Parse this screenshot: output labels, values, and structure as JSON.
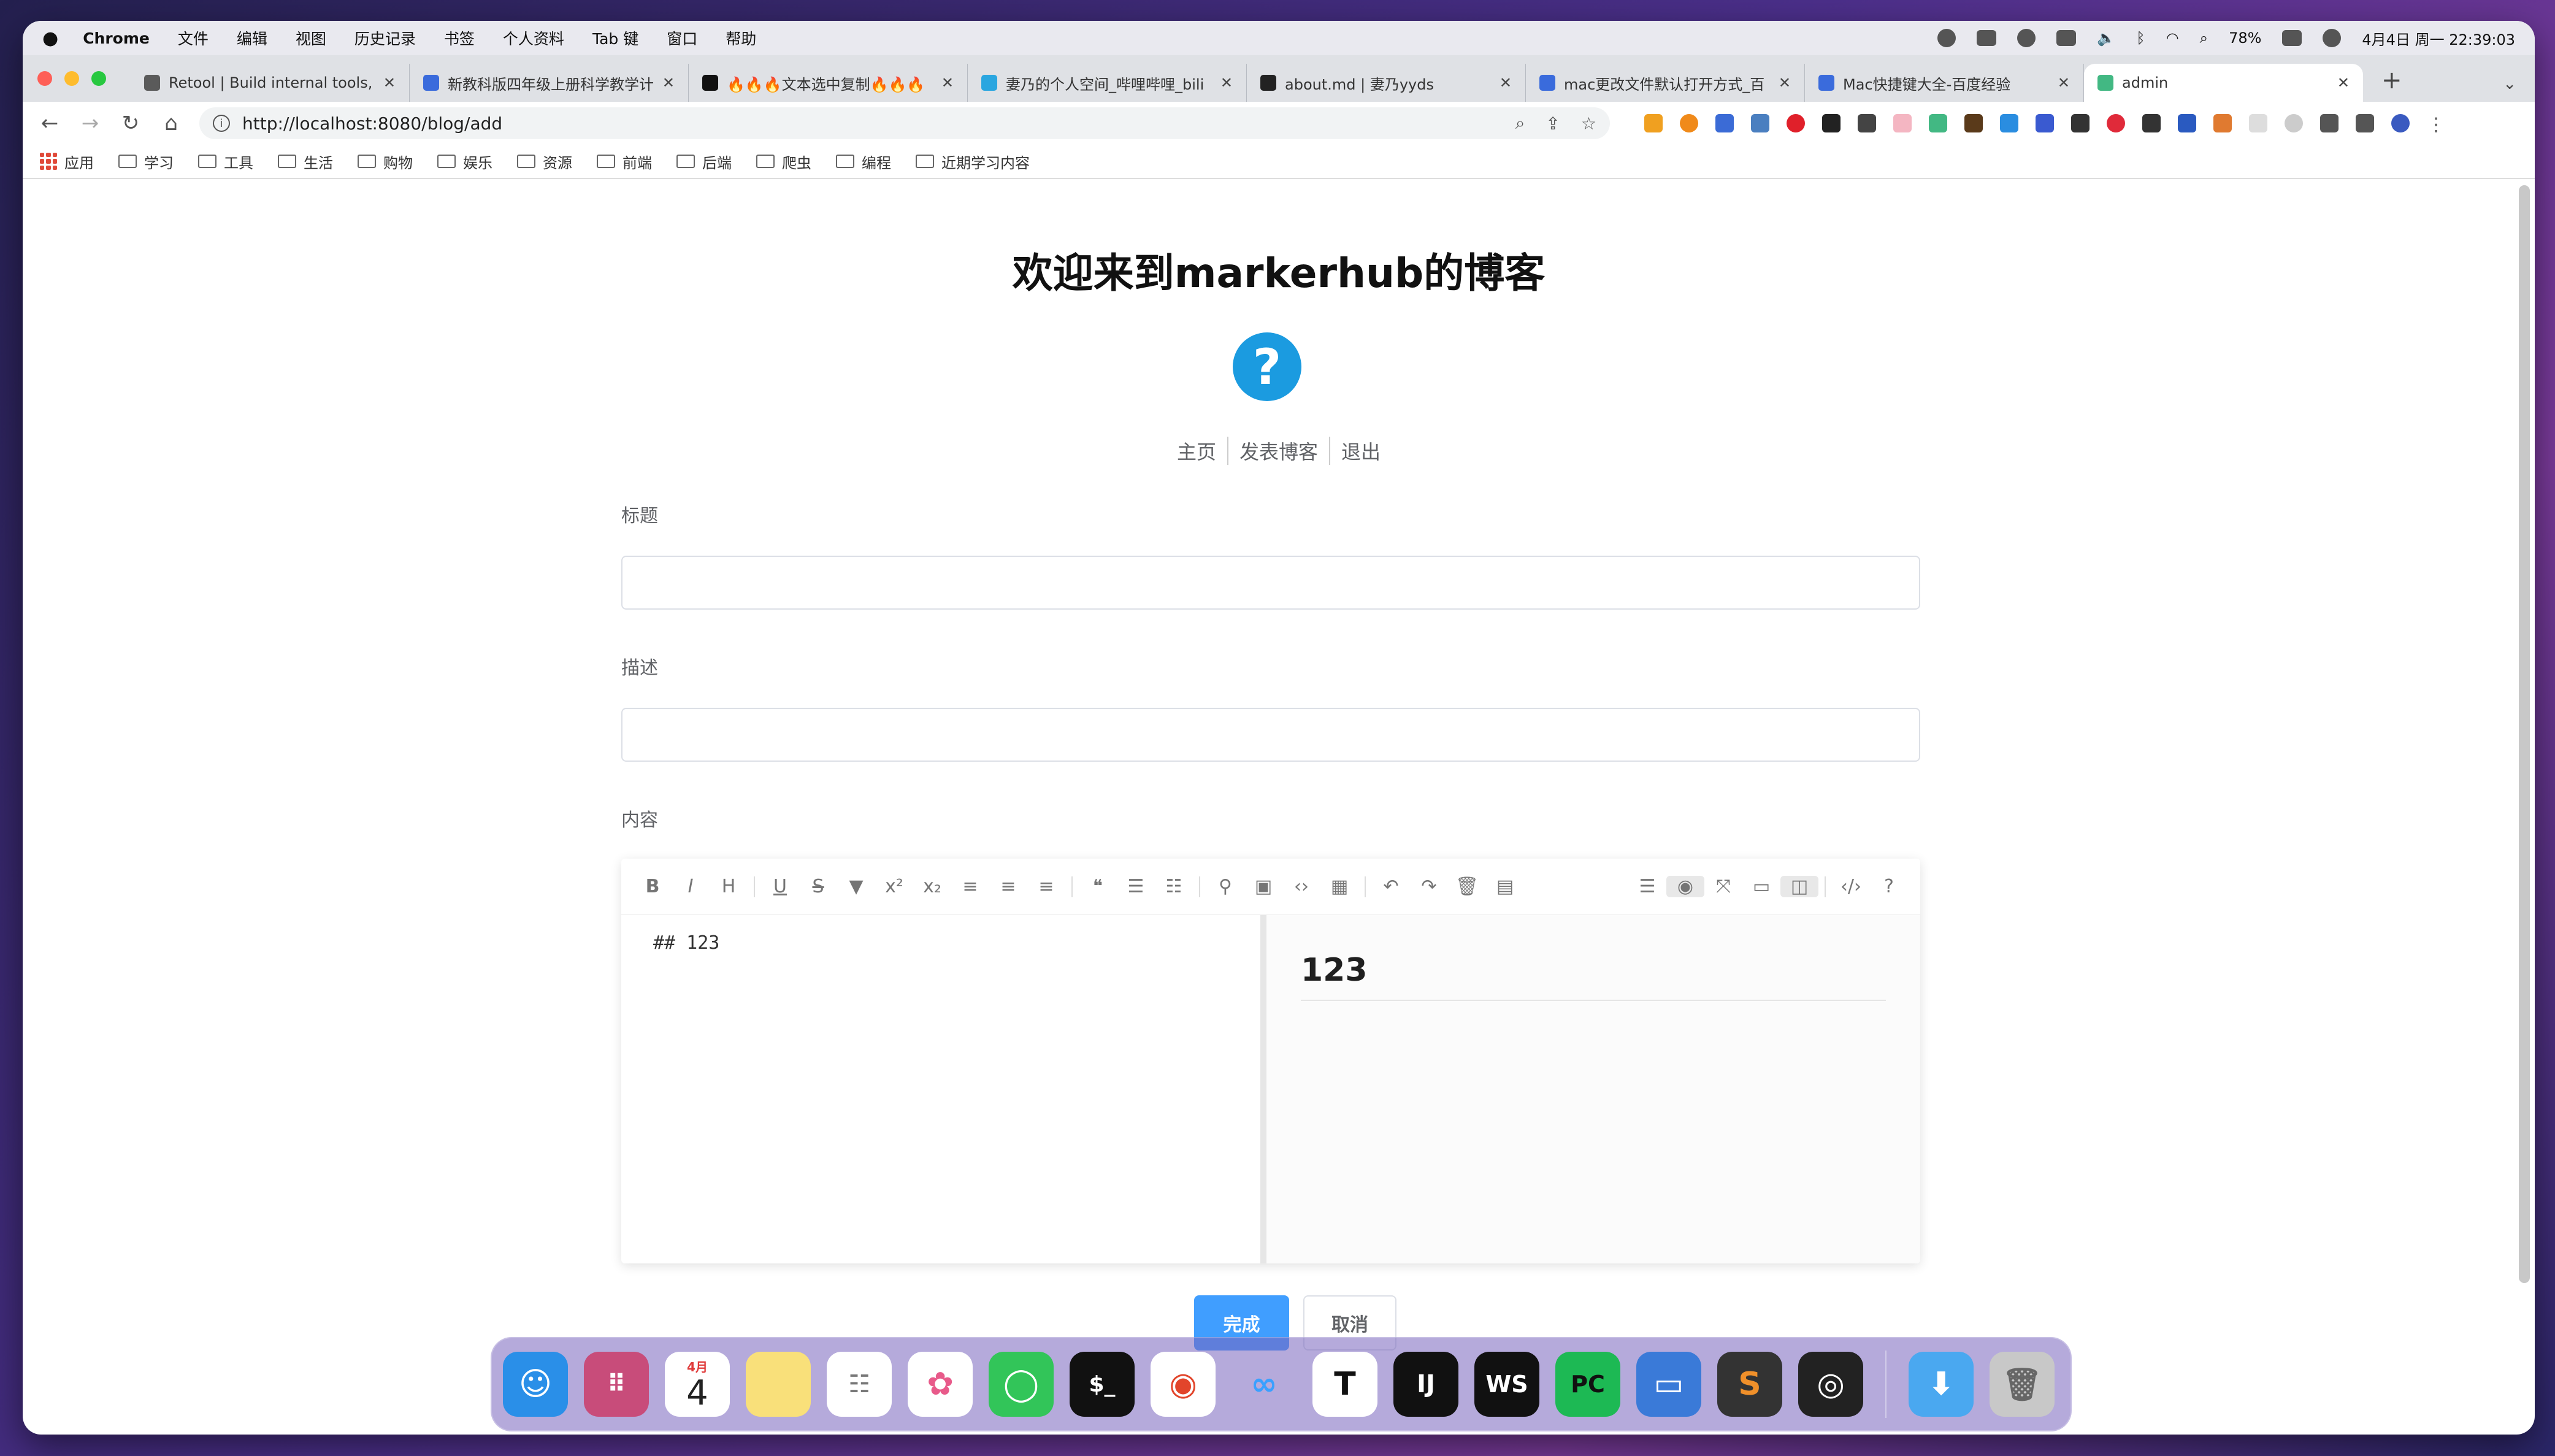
{
  "menubar": {
    "app": "Chrome",
    "items": [
      "文件",
      "编辑",
      "视图",
      "历史记录",
      "书签",
      "个人资料",
      "Tab 键",
      "窗口",
      "帮助"
    ],
    "battery": "78%",
    "clock": "4月4日 周一 22:39:03"
  },
  "tabs": [
    {
      "title": "Retool | Build internal tools, r",
      "color": "#5a5a5a"
    },
    {
      "title": "新教科版四年级上册科学教学计",
      "color": "#3a6bdc"
    },
    {
      "title": "🔥🔥🔥文本选中复制🔥🔥🔥",
      "color": "#111111"
    },
    {
      "title": "妻乃的个人空间_哔哩哔哩_bili",
      "color": "#2aa6e0"
    },
    {
      "title": "about.md | 妻乃yyds",
      "color": "#222222"
    },
    {
      "title": "mac更改文件默认打开方式_百",
      "color": "#3a6bdc"
    },
    {
      "title": "Mac快捷键大全-百度经验",
      "color": "#3a6bdc"
    },
    {
      "title": "admin",
      "color": "#42b883"
    }
  ],
  "url": "http://localhost:8080/blog/add",
  "bookmarks": [
    "应用",
    "学习",
    "工具",
    "生活",
    "购物",
    "娱乐",
    "资源",
    "前端",
    "后端",
    "爬虫",
    "编程",
    "近期学习内容"
  ],
  "page": {
    "title": "欢迎来到markerhub的博客",
    "nav": [
      "主页",
      "发表博客",
      "退出"
    ],
    "labels": {
      "title": "标题",
      "desc": "描述",
      "content": "内容"
    },
    "editor": {
      "source": "## 123",
      "preview_heading": "123"
    },
    "buttons": {
      "submit": "完成",
      "cancel": "取消"
    }
  },
  "dock": {
    "calendar_month": "4月",
    "calendar_day": "4"
  }
}
